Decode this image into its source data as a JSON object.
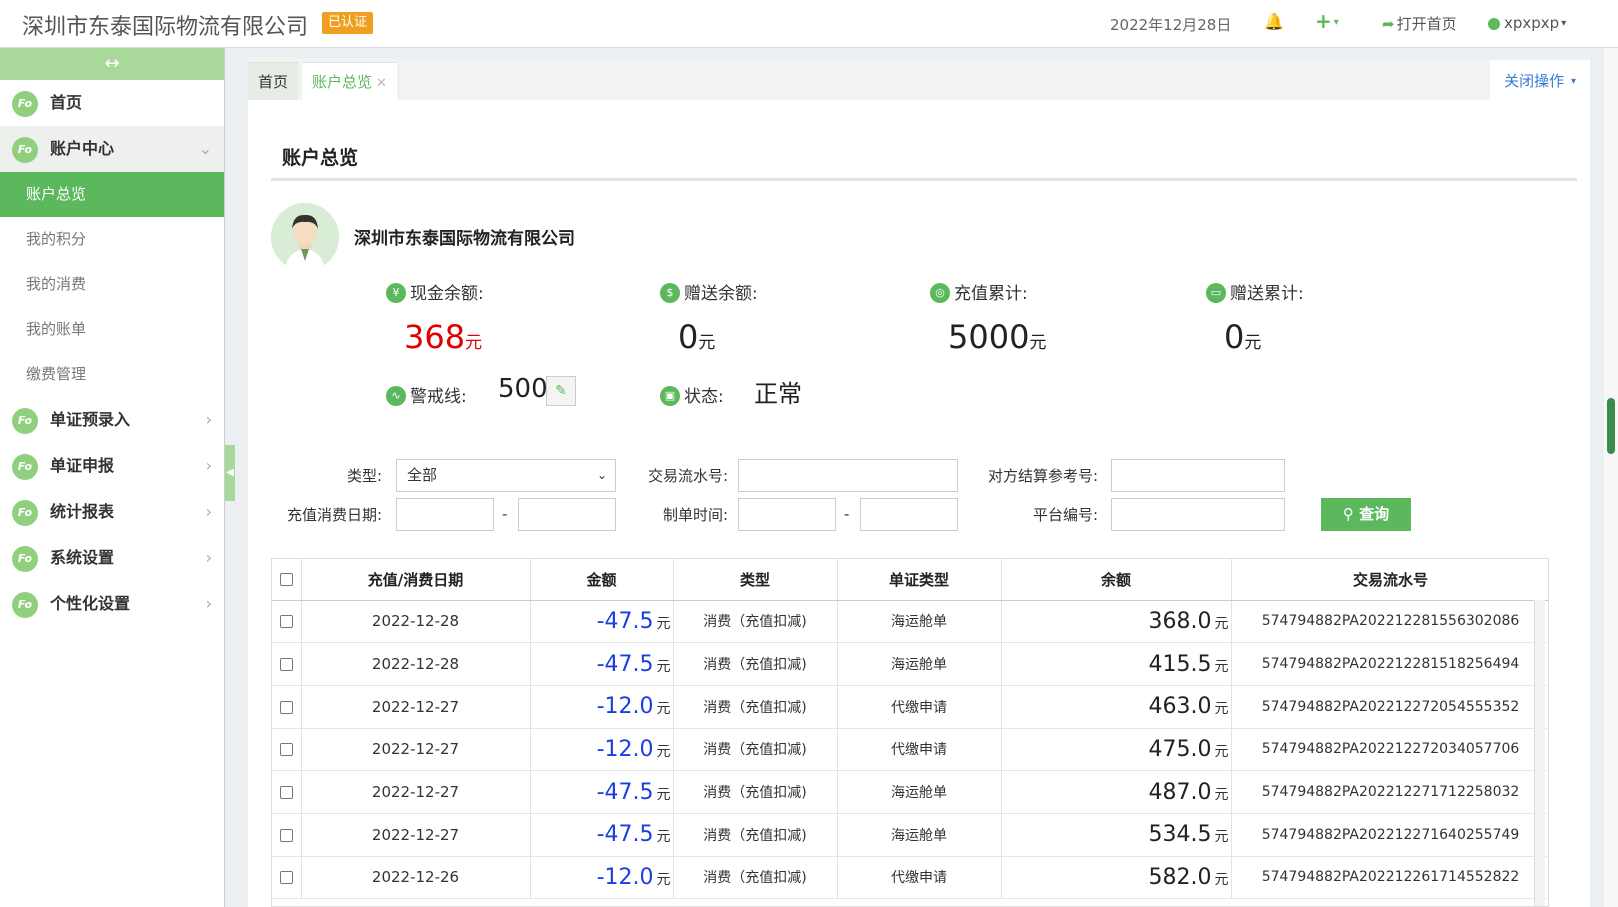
{
  "header": {
    "company": "深圳市东泰国际物流有限公司",
    "badge": "已认证",
    "date": "2022年12月28日",
    "open_home": "打开首页",
    "username": "xpxpxp"
  },
  "sidebar": {
    "items": [
      {
        "label": "首页"
      },
      {
        "label": "账户中心"
      },
      {
        "label": "单证预录入"
      },
      {
        "label": "单证申报"
      },
      {
        "label": "统计报表"
      },
      {
        "label": "系统设置"
      },
      {
        "label": "个性化设置"
      }
    ],
    "sub_items": [
      {
        "label": "账户总览"
      },
      {
        "label": "我的积分"
      },
      {
        "label": "我的消费"
      },
      {
        "label": "我的账单"
      },
      {
        "label": "缴费管理"
      }
    ]
  },
  "tabs": [
    {
      "label": "首页"
    },
    {
      "label": "账户总览"
    }
  ],
  "close_ops": "关闭操作",
  "page": {
    "title": "账户总览",
    "company_name": "深圳市东泰国际物流有限公司"
  },
  "stats": {
    "cash_label": "现金余额:",
    "cash_value": "368",
    "gift_label": "赠送余额:",
    "gift_value": "0",
    "recharge_label": "充值累计:",
    "recharge_value": "5000",
    "gift_total_label": "赠送累计:",
    "gift_total_value": "0",
    "unit": "元",
    "warn_label": "警戒线:",
    "warn_value": "500",
    "status_label": "状态:",
    "status_value": "正常"
  },
  "filters": {
    "type_label": "类型:",
    "type_value": "全部",
    "txn_label": "交易流水号:",
    "ref_label": "对方结算参考号:",
    "date_label": "充值消费日期:",
    "make_time_label": "制单时间:",
    "platform_label": "平台编号:",
    "dash": "-",
    "query": "查询"
  },
  "table": {
    "headers": [
      "充值/消费日期",
      "金额",
      "类型",
      "单证类型",
      "余额",
      "交易流水号"
    ],
    "unit": "元",
    "rows": [
      {
        "date": "2022-12-28",
        "amount": "-47.5",
        "type": "消费（充值扣减)",
        "doc": "海运舱单",
        "balance": "368.0",
        "txn": "574794882PA202212281556302086"
      },
      {
        "date": "2022-12-28",
        "amount": "-47.5",
        "type": "消费（充值扣减)",
        "doc": "海运舱单",
        "balance": "415.5",
        "txn": "574794882PA202212281518256494"
      },
      {
        "date": "2022-12-27",
        "amount": "-12.0",
        "type": "消费（充值扣减)",
        "doc": "代缴申请",
        "balance": "463.0",
        "txn": "574794882PA202212272054555352"
      },
      {
        "date": "2022-12-27",
        "amount": "-12.0",
        "type": "消费（充值扣减)",
        "doc": "代缴申请",
        "balance": "475.0",
        "txn": "574794882PA202212272034057706"
      },
      {
        "date": "2022-12-27",
        "amount": "-47.5",
        "type": "消费（充值扣减)",
        "doc": "海运舱单",
        "balance": "487.0",
        "txn": "574794882PA202212271712258032"
      },
      {
        "date": "2022-12-27",
        "amount": "-47.5",
        "type": "消费（充值扣减)",
        "doc": "海运舱单",
        "balance": "534.5",
        "txn": "574794882PA202212271640255749"
      },
      {
        "date": "2022-12-26",
        "amount": "-12.0",
        "type": "消费（充值扣减)",
        "doc": "代缴申请",
        "balance": "582.0",
        "txn": "574794882PA202212261714552822"
      }
    ]
  }
}
